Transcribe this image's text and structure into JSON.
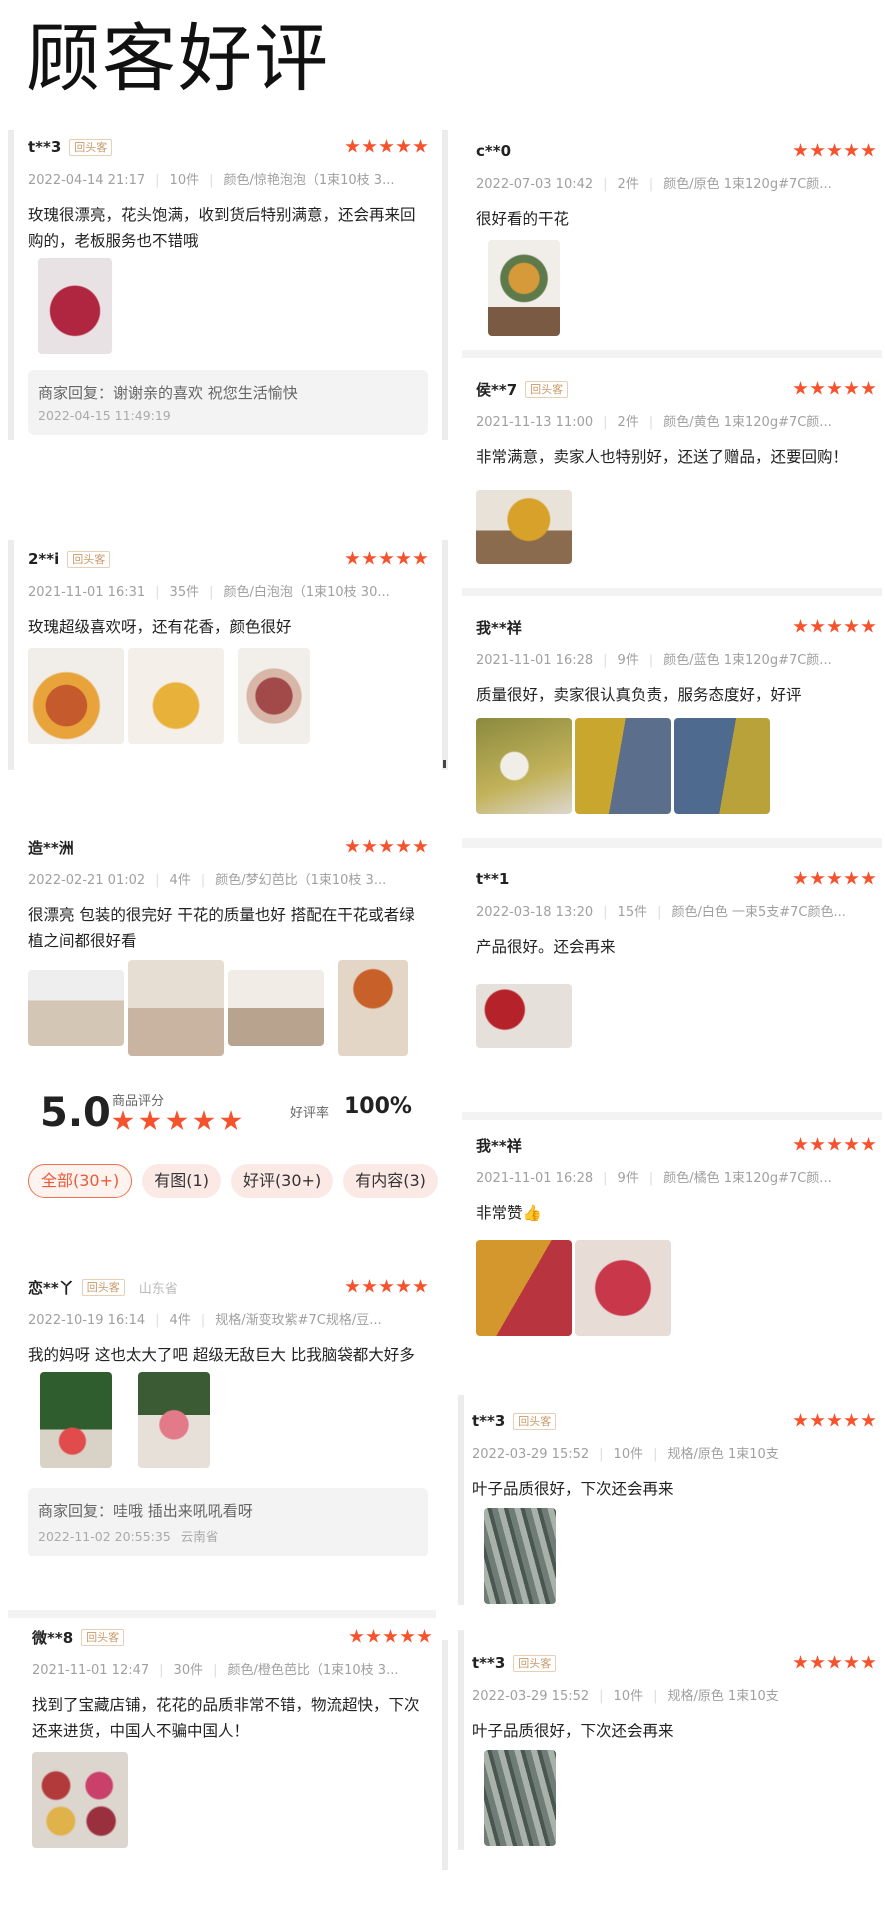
{
  "page_title": "顾客好评",
  "returning_badge": "回头客",
  "summary": {
    "score": "5.0",
    "score_label": "商品评分",
    "good_rate_label": "好评率",
    "good_rate": "100%",
    "filters": [
      "全部(30+)",
      "有图(1)",
      "好评(30+)",
      "有内容(3)"
    ]
  },
  "reviews": [
    {
      "user": "t**3",
      "returning": true,
      "location": "",
      "date": "2022-04-14 21:17",
      "qty": "10件",
      "spec": "颜色/惊艳泡泡（1束10枝 3...",
      "text": "玫瑰很漂亮，花头饱满，收到货后特别满意，还会再来回购的，老板服务也不错哦",
      "reply": "商家回复：谢谢亲的喜欢 祝您生活愉快",
      "reply_date": "2022-04-15 11:49:19",
      "reply_loc": ""
    },
    {
      "user": "2**i",
      "returning": true,
      "location": "",
      "date": "2021-11-01 16:31",
      "qty": "35件",
      "spec": "颜色/白泡泡（1束10枝 30...",
      "text": "玫瑰超级喜欢呀，还有花香，颜色很好"
    },
    {
      "user": "造**洲",
      "returning": false,
      "location": "",
      "date": "2022-02-21 01:02",
      "qty": "4件",
      "spec": "颜色/梦幻芭比（1束10枝 3...",
      "text": "很漂亮 包装的很完好 干花的质量也好 搭配在干花或者绿植之间都很好看"
    },
    {
      "user": "恋**丫",
      "returning": true,
      "location": "山东省",
      "date": "2022-10-19 16:14",
      "qty": "4件",
      "spec": "规格/渐变玫紫#7C规格/豆...",
      "text": "我的妈呀 这也太大了吧 超级无敌巨大 比我脑袋都大好多",
      "reply": "商家回复：哇哦 插出来吼吼看呀",
      "reply_date": "2022-11-02 20:55:35",
      "reply_loc": "云南省"
    },
    {
      "user": "微**8",
      "returning": true,
      "location": "",
      "date": "2021-11-01 12:47",
      "qty": "30件",
      "spec": "颜色/橙色芭比（1束10枝 3...",
      "text": "找到了宝藏店铺，花花的品质非常不错，物流超快，下次还来进货，中国人不骗中国人！"
    },
    {
      "user": "c**0",
      "returning": false,
      "location": "",
      "date": "2022-07-03 10:42",
      "qty": "2件",
      "spec": "颜色/原色 1束120g#7C颜...",
      "text": "很好看的干花"
    },
    {
      "user": "侯**7",
      "returning": true,
      "location": "",
      "date": "2021-11-13 11:00",
      "qty": "2件",
      "spec": "颜色/黄色 1束120g#7C颜...",
      "text": "非常满意，卖家人也特别好，还送了赠品，还要回购！"
    },
    {
      "user": "我**祥",
      "returning": false,
      "location": "",
      "date": "2021-11-01 16:28",
      "qty": "9件",
      "spec": "颜色/蓝色 1束120g#7C颜...",
      "text": "质量很好，卖家很认真负责，服务态度好，好评"
    },
    {
      "user": "t**1",
      "returning": false,
      "location": "",
      "date": "2022-03-18 13:20",
      "qty": "15件",
      "spec": "颜色/白色 一束5支#7C颜色...",
      "text": "产品很好。还会再来"
    },
    {
      "user": "我**祥",
      "returning": false,
      "location": "",
      "date": "2021-11-01 16:28",
      "qty": "9件",
      "spec": "颜色/橘色 1束120g#7C颜...",
      "text": "非常赞👍"
    },
    {
      "user": "t**3",
      "returning": true,
      "location": "",
      "date": "2022-03-29 15:52",
      "qty": "10件",
      "spec": "规格/原色 1束10支",
      "text": "叶子品质很好，下次还会再来"
    },
    {
      "user": "t**3",
      "returning": true,
      "location": "",
      "date": "2022-03-29 15:52",
      "qty": "10件",
      "spec": "规格/原色 1束10支",
      "text": "叶子品质很好，下次还会再来"
    }
  ]
}
